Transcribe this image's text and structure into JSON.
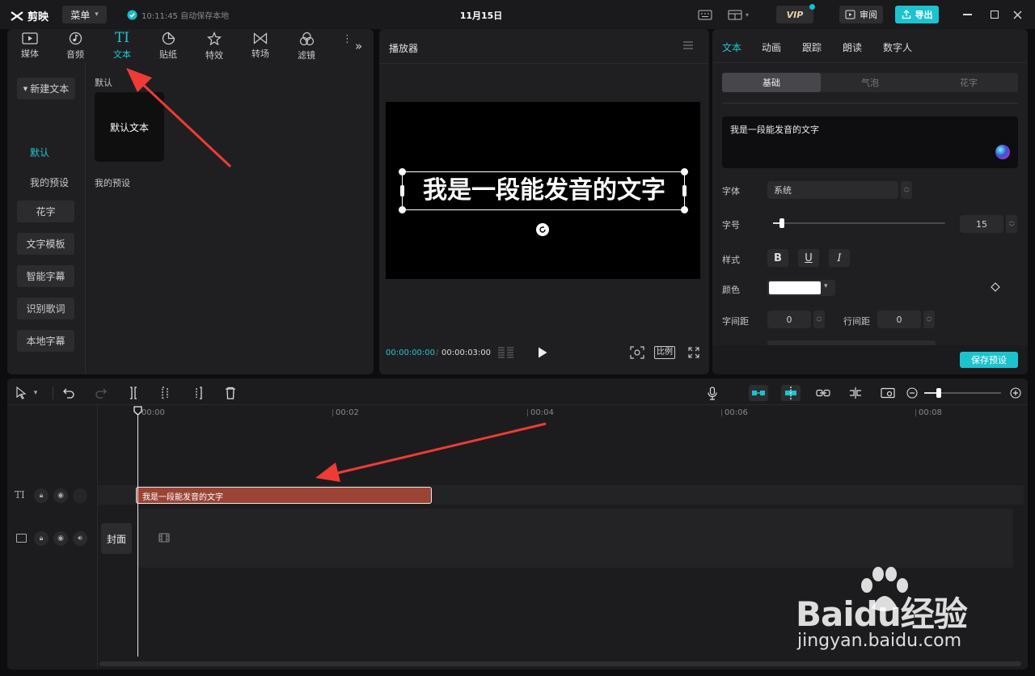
{
  "app": {
    "name": "剪映",
    "menu_label": "菜单",
    "autosave": "10:11:45 自动保存本地",
    "project_title": "11月15日",
    "vip_label": "VIP",
    "review_label": "审阅",
    "export_label": "导出"
  },
  "toolbar_tabs": [
    {
      "label": "媒体",
      "icon": "media-icon"
    },
    {
      "label": "音频",
      "icon": "audio-icon"
    },
    {
      "label": "文本",
      "icon": "text-icon"
    },
    {
      "label": "贴纸",
      "icon": "sticker-icon"
    },
    {
      "label": "特效",
      "icon": "effects-icon"
    },
    {
      "label": "转场",
      "icon": "transition-icon"
    },
    {
      "label": "滤镜",
      "icon": "filter-icon"
    }
  ],
  "left_sidebar": {
    "items": [
      "新建文本",
      "默认",
      "我的预设",
      "花字",
      "文字模板",
      "智能字幕",
      "识别歌词",
      "本地字幕"
    ]
  },
  "text_library": {
    "section_default": "默认",
    "card_label": "默认文本",
    "section_presets": "我的预设"
  },
  "player": {
    "title": "播放器",
    "caption": "我是一段能发音的文字",
    "current_time": "00:00:00:00",
    "total_time": "00:00:03:00",
    "ratio_label": "比例"
  },
  "properties": {
    "tabs": [
      "文本",
      "动画",
      "跟踪",
      "朗读",
      "数字人"
    ],
    "subtabs": [
      "基础",
      "气泡",
      "花字"
    ],
    "text_value": "我是一段能发音的文字",
    "font_label": "字体",
    "font_value": "系统",
    "size_label": "字号",
    "size_value": "15",
    "size_fraction": 0.05,
    "style_label": "样式",
    "style_buttons": [
      "B",
      "U",
      "I"
    ],
    "color_label": "颜色",
    "color_value": "#ffffff",
    "letter_spacing_label": "字间距",
    "letter_spacing_value": "0",
    "line_spacing_label": "行间距",
    "line_spacing_value": "0",
    "save_preset_label": "保存预设"
  },
  "timeline": {
    "ticks": [
      "00:00",
      "00:02",
      "00:04",
      "00:06",
      "00:08"
    ],
    "text_clip_label": "我是一段能发音的文字",
    "cover_label": "封面"
  },
  "colors": {
    "accent": "#00c8d8",
    "clip": "#9b4436",
    "arrow": "#ee3b36"
  },
  "watermark": {
    "brand": "Baidu经验",
    "url": "jingyan.baidu.com"
  }
}
